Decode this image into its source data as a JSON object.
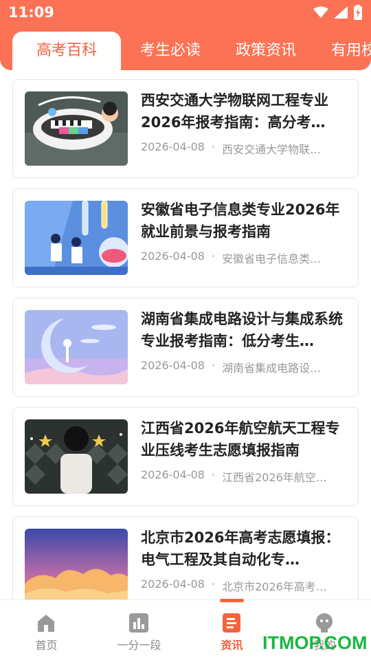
{
  "status_bar": {
    "time": "11:09"
  },
  "tabs": [
    {
      "label": "高考百科",
      "active": true
    },
    {
      "label": "考生必读",
      "active": false
    },
    {
      "label": "政策资讯",
      "active": false
    },
    {
      "label": "有用校",
      "active": false
    }
  ],
  "articles": [
    {
      "title": "西安交通大学物联网工程专业2026年报考指南：高分考…",
      "date": "2026-04-08",
      "source": "西安交通大学物联…",
      "image": "piano-cup-illustration"
    },
    {
      "title": "安徽省电子信息类专业2026年就业前景与报考指南",
      "date": "2026-04-08",
      "source": "安徽省电子信息类…",
      "image": "lab-scientists-illustration"
    },
    {
      "title": "湖南省集成电路设计与集成系统专业报考指南：低分考生…",
      "date": "2026-04-08",
      "source": "湖南省集成电路设…",
      "image": "moon-illustration"
    },
    {
      "title": "江西省2026年航空航天工程专业压线考生志愿填报指南",
      "date": "2026-04-08",
      "source": "江西省2026年航空…",
      "image": "girl-stars-illustration"
    },
    {
      "title": "北京市2026年高考志愿填报：电气工程及其自动化专…",
      "date": "2026-04-08",
      "source": "北京市2026年高考…",
      "image": "sunset-clouds-illustration"
    }
  ],
  "meta_separator": "·",
  "bottom_nav": [
    {
      "label": "首页",
      "icon": "home-icon",
      "active": false
    },
    {
      "label": "一分一段",
      "icon": "chart-icon",
      "active": false
    },
    {
      "label": "资讯",
      "icon": "news-icon",
      "active": true
    },
    {
      "label": "我的",
      "icon": "profile-icon",
      "active": false
    }
  ],
  "watermark": "ITMOP.COM",
  "colors": {
    "brand": "#fb7254",
    "accent_text": "#f4623f",
    "watermark": "#19b63e"
  }
}
